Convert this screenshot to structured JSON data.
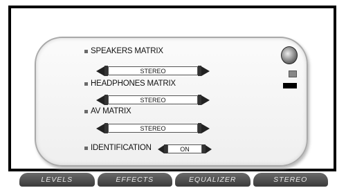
{
  "settings": {
    "speakers_matrix": {
      "label": "SPEAKERS MATRIX",
      "value": "STEREO"
    },
    "headphones_matrix": {
      "label": "HEADPHONES MATRIX",
      "value": "STEREO"
    },
    "av_matrix": {
      "label": "AV MATRIX",
      "value": "STEREO"
    },
    "identification": {
      "label": "IDENTIFICATION",
      "value": "ON"
    }
  },
  "tabs": [
    "LEVELS",
    "EFFECTS",
    "EQUALIZER",
    "STEREO"
  ],
  "icons": {
    "logo": "brand-logo-icon",
    "device": "device-icon",
    "indicator": "black-bar-indicator"
  }
}
